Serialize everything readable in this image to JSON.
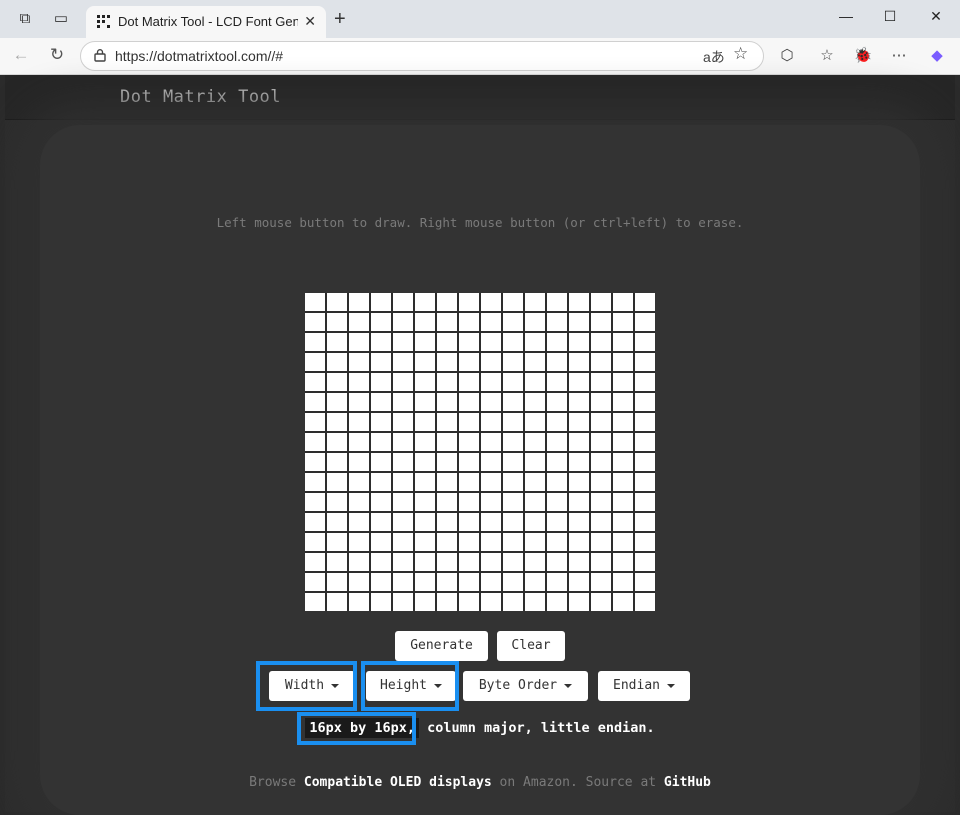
{
  "browser": {
    "tab_title": "Dot Matrix Tool - LCD Font Gener",
    "url": "https://dotmatrixtool.com//#",
    "reader_glyph": "aあ"
  },
  "site": {
    "brand": "Dot Matrix Tool",
    "hint": "Left mouse button to draw. Right mouse button (or ctrl+left) to erase."
  },
  "grid": {
    "columns": 16,
    "rows": 16
  },
  "buttons": {
    "generate": "Generate",
    "clear": "Clear",
    "width": "Width",
    "height": "Height",
    "byte_order": "Byte Order",
    "endian": "Endian"
  },
  "status": {
    "size": "16px by 16px,",
    "rest": " column major, little endian."
  },
  "footer": {
    "browse": "Browse ",
    "displays_link": "Compatible OLED displays",
    "amazon": " on Amazon. Source at ",
    "github_link": "GitHub"
  },
  "colors": {
    "highlight": "#1a8ff0",
    "page_bg": "#2d2d2d",
    "cell": "#ffffff"
  }
}
